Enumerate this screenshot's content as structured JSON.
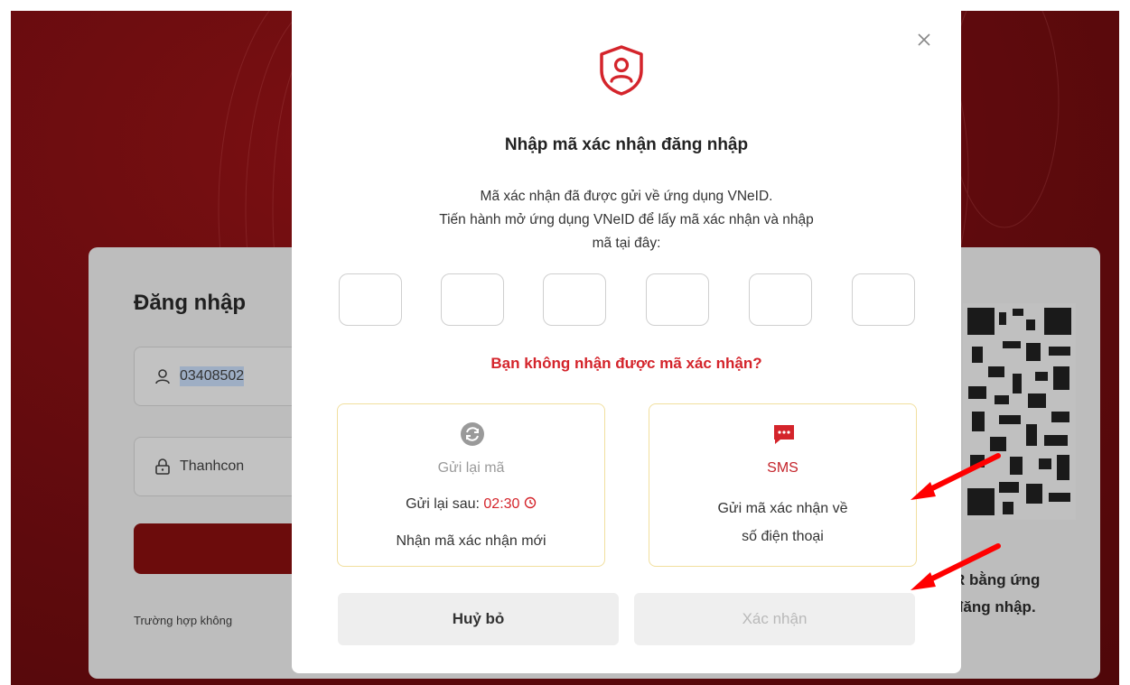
{
  "login": {
    "title": "Đăng nhập",
    "username_value": "03408502",
    "password_value": "Thanhcon",
    "note": "Trường hợp không",
    "qr_text_line1": "R bằng ứng",
    "qr_text_line2": "đăng nhập."
  },
  "modal": {
    "title": "Nhập mã xác nhận đăng nhập",
    "desc_line1": "Mã xác nhận đã được gửi về ứng dụng VNeID.",
    "desc_line2": "Tiến hành mở ứng dụng VNeID để lấy mã xác nhận và nhập",
    "desc_line3": "mã tại đây:",
    "code_digits": [
      "",
      "",
      "",
      "",
      "",
      ""
    ],
    "not_received": "Bạn không nhận được mã xác nhận?",
    "resend": {
      "label": "Gửi lại mã",
      "countdown_prefix": "Gửi lại sau:",
      "countdown": "02:30",
      "subtitle": "Nhận mã xác nhận mới"
    },
    "sms": {
      "label": "SMS",
      "line1": "Gửi mã xác nhận về",
      "line2": "số điện thoại"
    },
    "cancel_label": "Huỷ bỏ",
    "confirm_label": "Xác nhận"
  },
  "colors": {
    "accent_red": "#d4242b",
    "background_dark_red": "#6b0c10",
    "card_border_yellow": "#f1df9e",
    "arrow_red": "#ff0000"
  },
  "icons": [
    "shield-user-icon",
    "close-icon",
    "refresh-icon",
    "sms-icon",
    "clock-icon",
    "user-icon",
    "lock-icon"
  ]
}
